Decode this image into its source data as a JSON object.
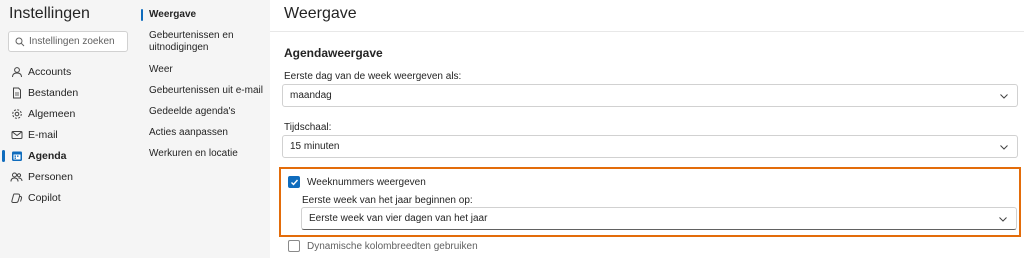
{
  "sidebar": {
    "title": "Instellingen",
    "search_placeholder": "Instellingen zoeken",
    "items": [
      {
        "label": "Accounts",
        "icon": "person-icon"
      },
      {
        "label": "Bestanden",
        "icon": "document-icon"
      },
      {
        "label": "Algemeen",
        "icon": "gear-icon"
      },
      {
        "label": "E-mail",
        "icon": "mail-icon"
      },
      {
        "label": "Agenda",
        "icon": "calendar-icon",
        "active": true
      },
      {
        "label": "Personen",
        "icon": "people-icon"
      },
      {
        "label": "Copilot",
        "icon": "copilot-icon"
      }
    ]
  },
  "subnav": {
    "items": [
      {
        "label": "Weergave",
        "active": true
      },
      {
        "label": "Gebeurtenissen en uitnodigingen"
      },
      {
        "label": "Weer"
      },
      {
        "label": "Gebeurtenissen uit e-mail"
      },
      {
        "label": "Gedeelde agenda's"
      },
      {
        "label": "Acties aanpassen"
      },
      {
        "label": "Werkuren en locatie"
      }
    ]
  },
  "main": {
    "title": "Weergave",
    "section_title": "Agendaweergave",
    "first_day_label": "Eerste dag van de week weergeven als:",
    "first_day_value": "maandag",
    "timescale_label": "Tijdschaal:",
    "timescale_value": "15 minuten",
    "week_numbers_label": "Weeknummers weergeven",
    "week_numbers_checked": true,
    "first_week_label": "Eerste week van het jaar beginnen op:",
    "first_week_value": "Eerste week van vier dagen van het jaar",
    "dynamic_columns_label": "Dynamische kolombreedten gebruiken",
    "dynamic_columns_checked": false
  },
  "colors": {
    "accent": "#0f6cbd",
    "highlight": "#e36c0a"
  }
}
